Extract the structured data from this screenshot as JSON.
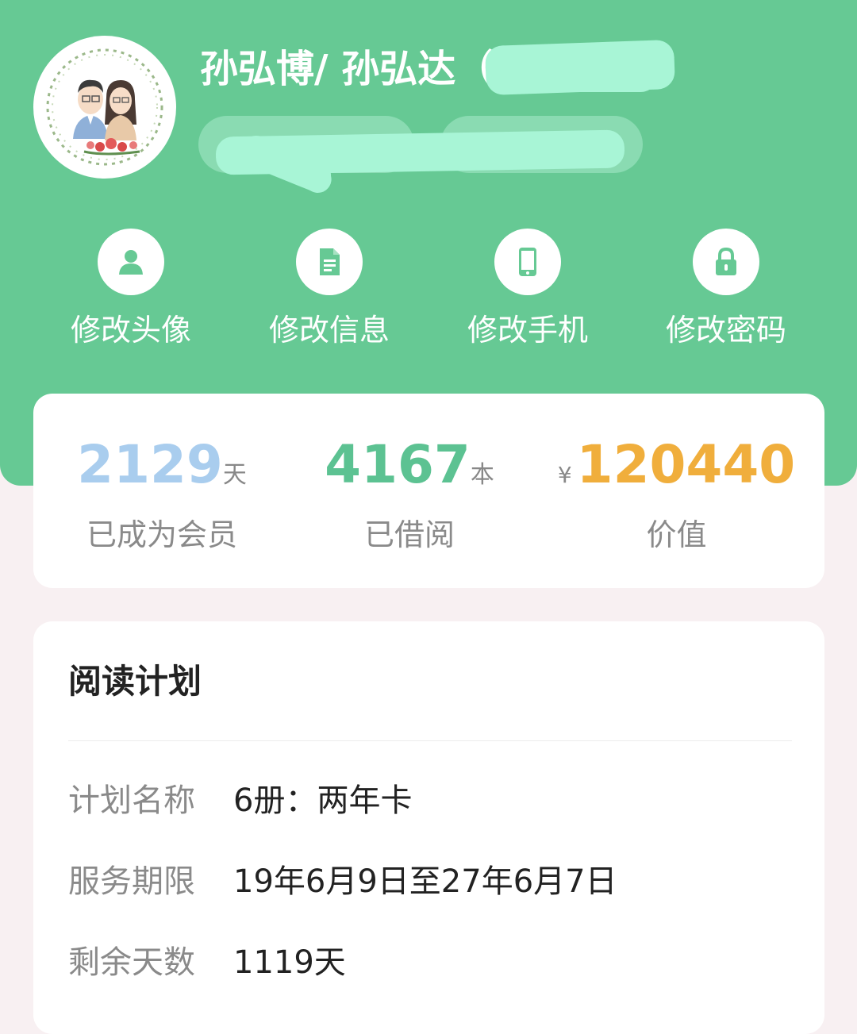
{
  "profile": {
    "name": "孙弘博/ 孙弘达",
    "name_paren": "（"
  },
  "actions": [
    {
      "label": "修改头像",
      "icon": "user-icon"
    },
    {
      "label": "修改信息",
      "icon": "document-icon"
    },
    {
      "label": "修改手机",
      "icon": "phone-icon"
    },
    {
      "label": "修改密码",
      "icon": "lock-icon"
    }
  ],
  "stats": {
    "member_days": {
      "value": "2129",
      "unit": "天",
      "label": "已成为会员",
      "color": "#a9cdee"
    },
    "borrowed": {
      "value": "4167",
      "unit": "本",
      "label": "已借阅",
      "color": "#5cc292"
    },
    "worth": {
      "currency": "¥",
      "value": "120440",
      "label": "价值",
      "color": "#f0ae3c"
    }
  },
  "plan": {
    "title": "阅读计划",
    "rows": [
      {
        "key": "计划名称",
        "value": "6册：两年卡"
      },
      {
        "key": "服务期限",
        "value": "19年6月9日至27年6月7日"
      },
      {
        "key": "剩余天数",
        "value": "1119天"
      }
    ]
  },
  "colors": {
    "header_green": "#66c994",
    "redaction": "#a8f5d6",
    "icon_green": "#66c994"
  }
}
